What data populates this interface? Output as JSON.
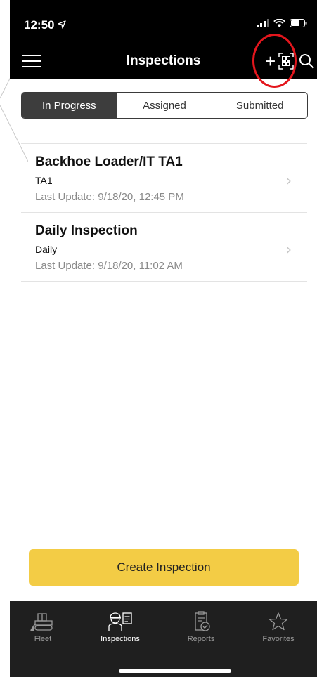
{
  "status_bar": {
    "time": "12:50",
    "location_icon": "location-arrow-icon",
    "signal_icon": "cellular-signal-icon",
    "wifi_icon": "wifi-icon",
    "battery_icon": "battery-icon"
  },
  "nav": {
    "title": "Inspections",
    "menu_icon": "hamburger-menu-icon",
    "add_label": "+",
    "qr_icon": "qr-code-scan-icon",
    "search_icon": "search-icon"
  },
  "highlight_color": "#e3161d",
  "segments": [
    {
      "label": "In Progress",
      "active": true
    },
    {
      "label": "Assigned",
      "active": false
    },
    {
      "label": "Submitted",
      "active": false
    }
  ],
  "inspections": [
    {
      "title": "Backhoe Loader/IT TA1",
      "subtitle": "TA1",
      "last_update": "Last Update: 9/18/20, 12:45 PM"
    },
    {
      "title": "Daily Inspection",
      "subtitle": "Daily",
      "last_update": "Last Update: 9/18/20, 11:02 AM"
    }
  ],
  "create_button": {
    "label": "Create Inspection",
    "color": "#f3cc45"
  },
  "tabs": [
    {
      "label": "Fleet",
      "icon": "bulldozer-icon",
      "active": false
    },
    {
      "label": "Inspections",
      "icon": "inspector-clipboard-icon",
      "active": true
    },
    {
      "label": "Reports",
      "icon": "report-checkmark-icon",
      "active": false
    },
    {
      "label": "Favorites",
      "icon": "star-icon",
      "active": false
    }
  ]
}
